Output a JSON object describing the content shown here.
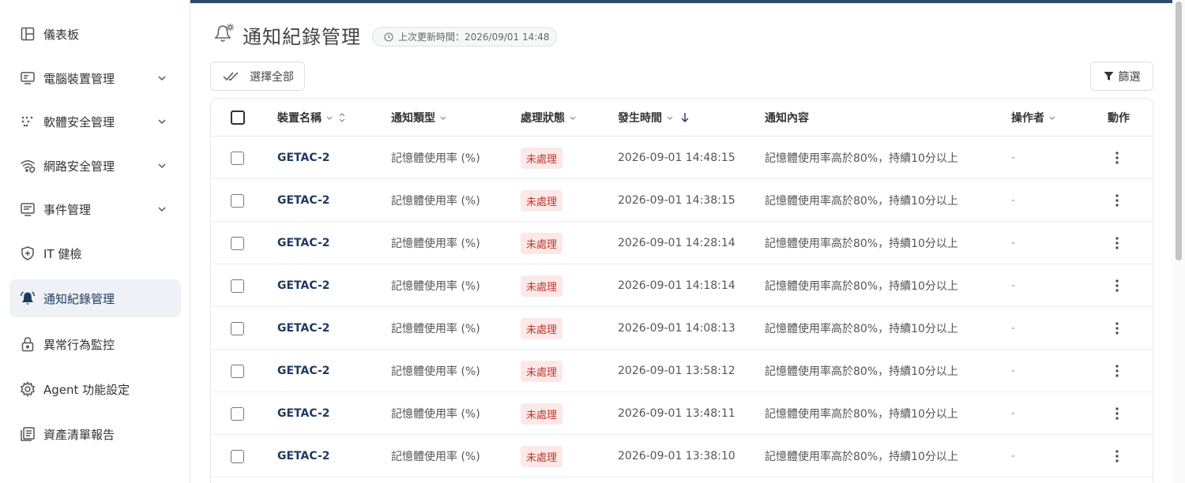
{
  "sidebar": {
    "items": [
      {
        "label": "儀表板",
        "icon": "layout-icon",
        "expandable": false
      },
      {
        "label": "電腦裝置管理",
        "icon": "monitor-icon",
        "expandable": true
      },
      {
        "label": "軟體安全管理",
        "icon": "dots-grid-icon",
        "expandable": true
      },
      {
        "label": "網路安全管理",
        "icon": "wifi-shield-icon",
        "expandable": true
      },
      {
        "label": "事件管理",
        "icon": "list-icon",
        "expandable": true
      },
      {
        "label": "IT 健檢",
        "icon": "shield-plus-icon",
        "expandable": false
      },
      {
        "label": "通知紀錄管理",
        "icon": "bell-icon",
        "expandable": false,
        "active": true
      },
      {
        "label": "異常行為監控",
        "icon": "lock-icon",
        "expandable": false
      },
      {
        "label": "Agent 功能設定",
        "icon": "gear-icon",
        "expandable": false
      },
      {
        "label": "資產清單報告",
        "icon": "report-icon",
        "expandable": false
      }
    ]
  },
  "header": {
    "title": "通知紀錄管理",
    "updated_label": "上次更新時間：2026/09/01 14:48"
  },
  "toolbar": {
    "select_all_label": "選擇全部",
    "filter_label": "篩選"
  },
  "table": {
    "columns": {
      "device": "裝置名稱",
      "type": "通知類型",
      "status": "處理狀態",
      "time": "發生時間",
      "content": "通知內容",
      "operator": "操作者",
      "action": "動作"
    },
    "rows": [
      {
        "device": "GETAC-2",
        "type": "記憶體使用率 (%)",
        "status": "未處理",
        "time": "2026-09-01 14:48:15",
        "content": "記憶體使用率高於80%，持續10分以上",
        "operator": "-"
      },
      {
        "device": "GETAC-2",
        "type": "記憶體使用率 (%)",
        "status": "未處理",
        "time": "2026-09-01 14:38:15",
        "content": "記憶體使用率高於80%，持續10分以上",
        "operator": "-"
      },
      {
        "device": "GETAC-2",
        "type": "記憶體使用率 (%)",
        "status": "未處理",
        "time": "2026-09-01 14:28:14",
        "content": "記憶體使用率高於80%，持續10分以上",
        "operator": "-"
      },
      {
        "device": "GETAC-2",
        "type": "記憶體使用率 (%)",
        "status": "未處理",
        "time": "2026-09-01 14:18:14",
        "content": "記憶體使用率高於80%，持續10分以上",
        "operator": "-"
      },
      {
        "device": "GETAC-2",
        "type": "記憶體使用率 (%)",
        "status": "未處理",
        "time": "2026-09-01 14:08:13",
        "content": "記憶體使用率高於80%，持續10分以上",
        "operator": "-"
      },
      {
        "device": "GETAC-2",
        "type": "記憶體使用率 (%)",
        "status": "未處理",
        "time": "2026-09-01 13:58:12",
        "content": "記憶體使用率高於80%，持續10分以上",
        "operator": "-"
      },
      {
        "device": "GETAC-2",
        "type": "記憶體使用率 (%)",
        "status": "未處理",
        "time": "2026-09-01 13:48:11",
        "content": "記憶體使用率高於80%，持續10分以上",
        "operator": "-"
      },
      {
        "device": "GETAC-2",
        "type": "記憶體使用率 (%)",
        "status": "未處理",
        "time": "2026-09-01 13:38:10",
        "content": "記憶體使用率高於80%，持續10分以上",
        "operator": "-"
      }
    ]
  },
  "colors": {
    "accent": "#1f3a5f",
    "status_bg": "#fde8e8",
    "status_text": "#c0392b"
  }
}
